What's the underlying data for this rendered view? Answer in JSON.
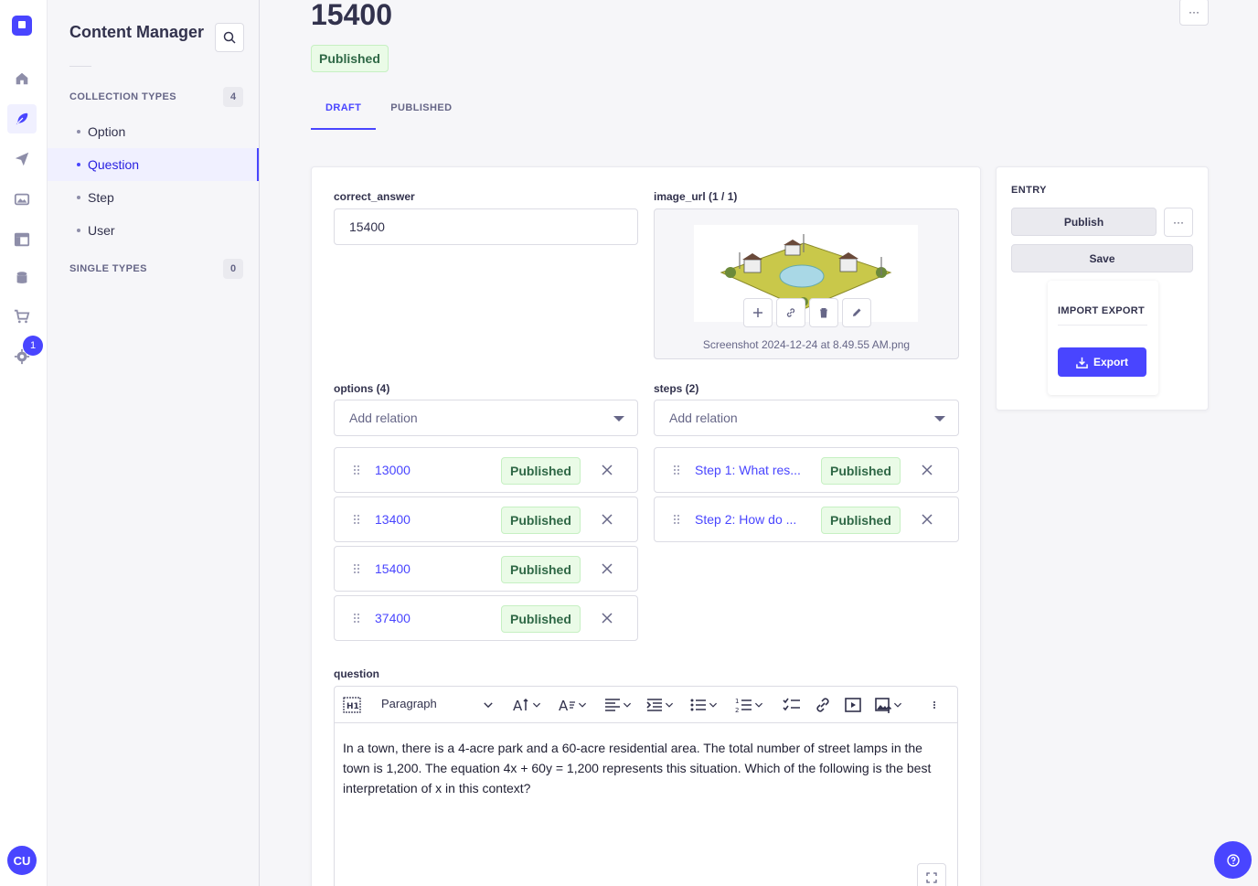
{
  "sidebar": {
    "title": "Content Manager",
    "collection_types_label": "COLLECTION TYPES",
    "collection_types_count": "4",
    "items": [
      {
        "label": "Option"
      },
      {
        "label": "Question"
      },
      {
        "label": "Step"
      },
      {
        "label": "User"
      }
    ],
    "single_types_label": "SINGLE TYPES",
    "single_types_count": "0"
  },
  "rail": {
    "settings_badge": "1",
    "avatar_initials": "CU"
  },
  "header": {
    "title": "15400",
    "status": "Published",
    "more_label": "···",
    "tabs": [
      {
        "label": "DRAFT"
      },
      {
        "label": "PUBLISHED"
      }
    ]
  },
  "form": {
    "correct_answer": {
      "label": "correct_answer",
      "value": "15400"
    },
    "image_url": {
      "label": "image_url (1 / 1)",
      "filename": "Screenshot 2024-12-24 at 8.49.55 AM.png"
    },
    "options": {
      "label": "options (4)",
      "placeholder": "Add relation",
      "items": [
        {
          "title": "13000",
          "status": "Published"
        },
        {
          "title": "13400",
          "status": "Published"
        },
        {
          "title": "15400",
          "status": "Published"
        },
        {
          "title": "37400",
          "status": "Published"
        }
      ]
    },
    "steps": {
      "label": "steps (2)",
      "placeholder": "Add relation",
      "items": [
        {
          "title": "Step 1: What res...",
          "status": "Published"
        },
        {
          "title": "Step 2: How do ...",
          "status": "Published"
        }
      ]
    },
    "question": {
      "label": "question",
      "block_type": "Paragraph",
      "text": "In a town, there is a 4-acre park and a 60-acre residential area. The total number of street lamps in the town is 1,200. The equation 4x + 60y = 1,200 represents this situation. Which of the following is the best interpretation of x in this context?"
    }
  },
  "entry_panel": {
    "section_label": "ENTRY",
    "publish_label": "Publish",
    "save_label": "Save",
    "more_label": "···",
    "import_export_label": "IMPORT EXPORT",
    "export_label": "Export"
  },
  "colors": {
    "primary": "#4945ff",
    "success_bg": "#eafbe7",
    "success_text": "#2f6846"
  }
}
